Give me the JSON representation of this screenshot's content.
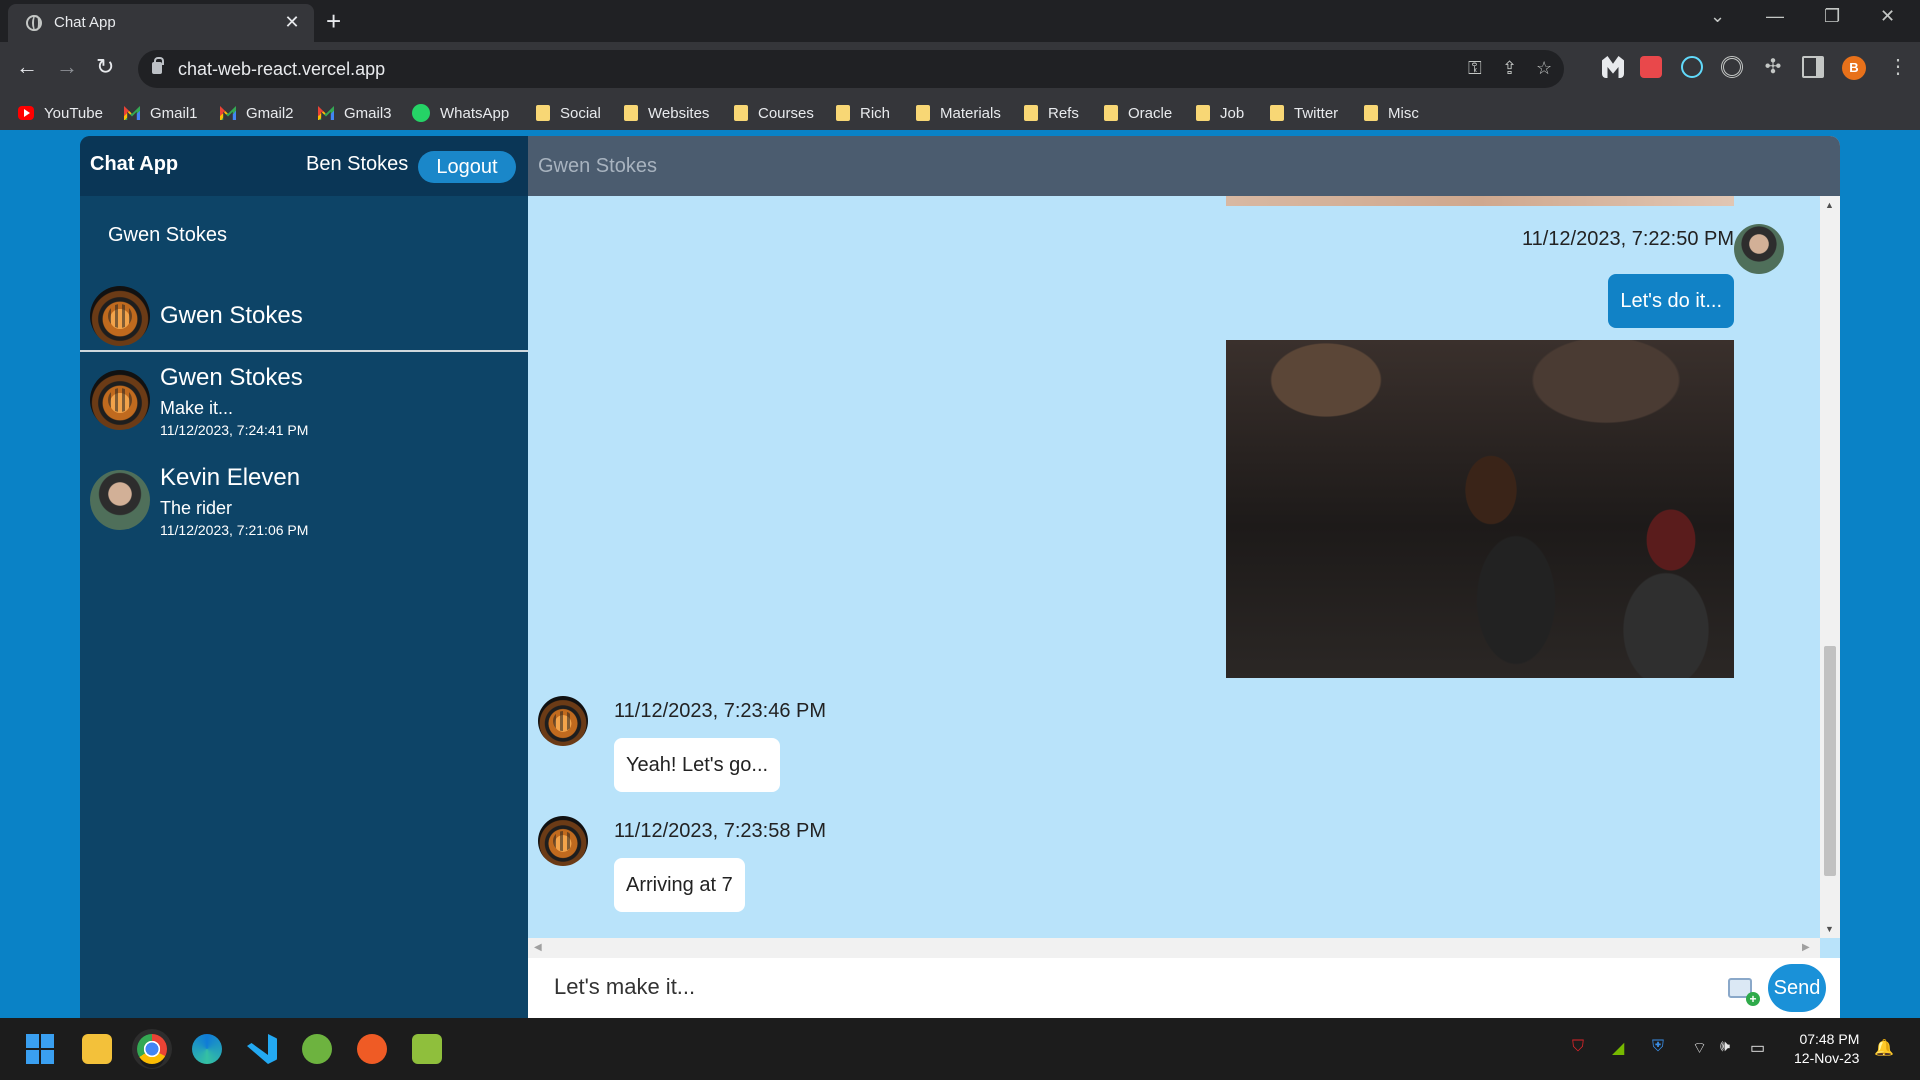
{
  "browser": {
    "tab_title": "Chat App",
    "url": "chat-web-react.vercel.app",
    "profile_initial": "B",
    "bookmarks": [
      {
        "label": "YouTube",
        "icon": "youtube-icon"
      },
      {
        "label": "Gmail1",
        "icon": "gmail-icon"
      },
      {
        "label": "Gmail2",
        "icon": "gmail-icon"
      },
      {
        "label": "Gmail3",
        "icon": "gmail-icon"
      },
      {
        "label": "WhatsApp",
        "icon": "whatsapp-icon"
      },
      {
        "label": "Social",
        "icon": "folder-icon"
      },
      {
        "label": "Websites",
        "icon": "folder-icon"
      },
      {
        "label": "Courses",
        "icon": "folder-icon"
      },
      {
        "label": "Rich",
        "icon": "folder-icon"
      },
      {
        "label": "Materials",
        "icon": "folder-icon"
      },
      {
        "label": "Refs",
        "icon": "folder-icon"
      },
      {
        "label": "Oracle",
        "icon": "folder-icon"
      },
      {
        "label": "Job",
        "icon": "folder-icon"
      },
      {
        "label": "Twitter",
        "icon": "folder-icon"
      },
      {
        "label": "Misc",
        "icon": "folder-icon"
      }
    ]
  },
  "app": {
    "brand": "Chat App",
    "user_name": "Ben Stokes",
    "logout_label": "Logout",
    "search_result": "Gwen Stokes",
    "active_contact": "Gwen Stokes",
    "conversations": [
      {
        "name": "Gwen Stokes",
        "preview": "Make it...",
        "time": "11/12/2023, 7:24:41 PM"
      },
      {
        "name": "Kevin Eleven",
        "preview": "The rider",
        "time": "11/12/2023, 7:21:06 PM"
      }
    ],
    "chat_header": "Gwen Stokes",
    "messages": [
      {
        "time": "11/12/2023, 7:22:50 PM",
        "text": "Let's do it...",
        "sender": "me"
      },
      {
        "time": "11/12/2023, 7:23:46 PM",
        "text": "Yeah! Let's go...",
        "sender": "them"
      },
      {
        "time": "11/12/2023, 7:23:58 PM",
        "text": "Arriving at 7",
        "sender": "them"
      }
    ],
    "composer_value": "Let's make it...",
    "send_label": "Send"
  },
  "taskbar": {
    "time": "07:48 PM",
    "date": "12-Nov-23"
  },
  "colors": {
    "page_bg": "#0a82c6",
    "sidebar_bg": "#0d4467",
    "chat_bg": "#b9e3fa",
    "outgoing_bubble": "#1182c6",
    "send_button": "#1a91d8"
  }
}
